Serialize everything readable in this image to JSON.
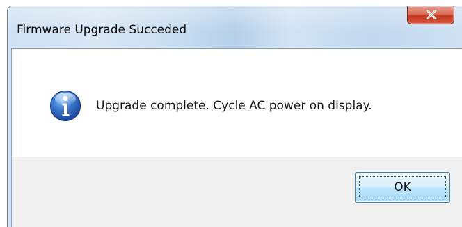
{
  "window": {
    "title": "Firmware Upgrade Succeded"
  },
  "titlebar": {
    "close_icon": "close-x-icon"
  },
  "dialog": {
    "icon": "info-icon",
    "message": "Upgrade complete.  Cycle AC power on display.",
    "ok_label": "OK"
  },
  "colors": {
    "close_button": "#c2371f",
    "info_icon": "#2b5fb4",
    "ok_border": "#3c7fb1"
  }
}
